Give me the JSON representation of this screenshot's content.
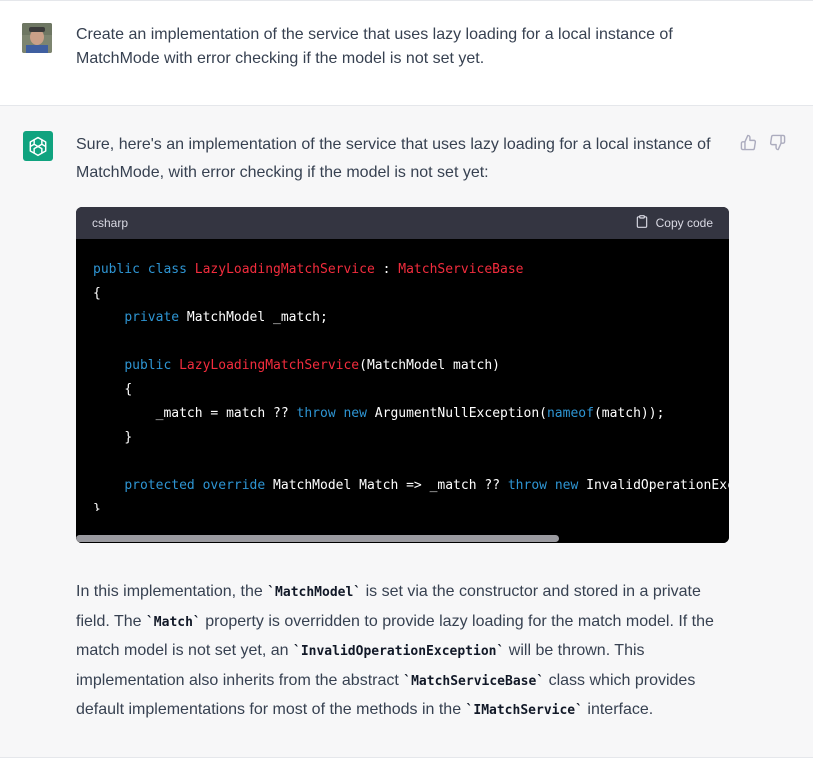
{
  "user": {
    "message": "Create an implementation of the service that uses lazy loading for a local instance of MatchMode with error checking if the model is not set yet."
  },
  "assistant": {
    "intro": "Sure, here's an implementation of the service that uses lazy loading for a local instance of MatchMode, with error checking if the model is not set yet:",
    "code_block": {
      "language": "csharp",
      "copy_label": "Copy code",
      "scroll_fraction_visible": 0.74
    },
    "explanation": {
      "p1": "In this implementation, the ",
      "code1": "`MatchModel`",
      "p2": " is set via the constructor and stored in a private field. The ",
      "code2": "`Match`",
      "p3": " property is overridden to provide lazy loading for the match model. If the match model is not set yet, an ",
      "code3": "`InvalidOperationException`",
      "p4": " will be thrown. This implementation also inherits from the abstract ",
      "code4": "`MatchServiceBase`",
      "p5": " class which provides default implementations for most of the methods in the ",
      "code5": "`IMatchService`",
      "p6": " interface."
    }
  },
  "code": {
    "l1": {
      "a": "public",
      "b": "class",
      "c": "LazyLoadingMatchService",
      "d": " : ",
      "e": "MatchServiceBase"
    },
    "l2": "{",
    "l3": {
      "a": "private",
      "b": " MatchModel _match;"
    },
    "l5": {
      "a": "public",
      "b": "LazyLoadingMatchService",
      "c": "(MatchModel match)"
    },
    "l6": "{",
    "l7": {
      "a": "_match = match ?? ",
      "b": "throw",
      "c": "new",
      "d": " ArgumentNullException(",
      "e": "nameof",
      "f": "(match));"
    },
    "l8": "}",
    "l10": {
      "a": "protected",
      "b": "override",
      "c": " MatchModel Match => _match ?? ",
      "d": "throw",
      "e": "new",
      "f": " InvalidOperationExce"
    },
    "l11": "}"
  },
  "colors": {
    "keyword": "#2e95d3",
    "type": "#f22c3d",
    "bot_avatar": "#10a37f"
  }
}
